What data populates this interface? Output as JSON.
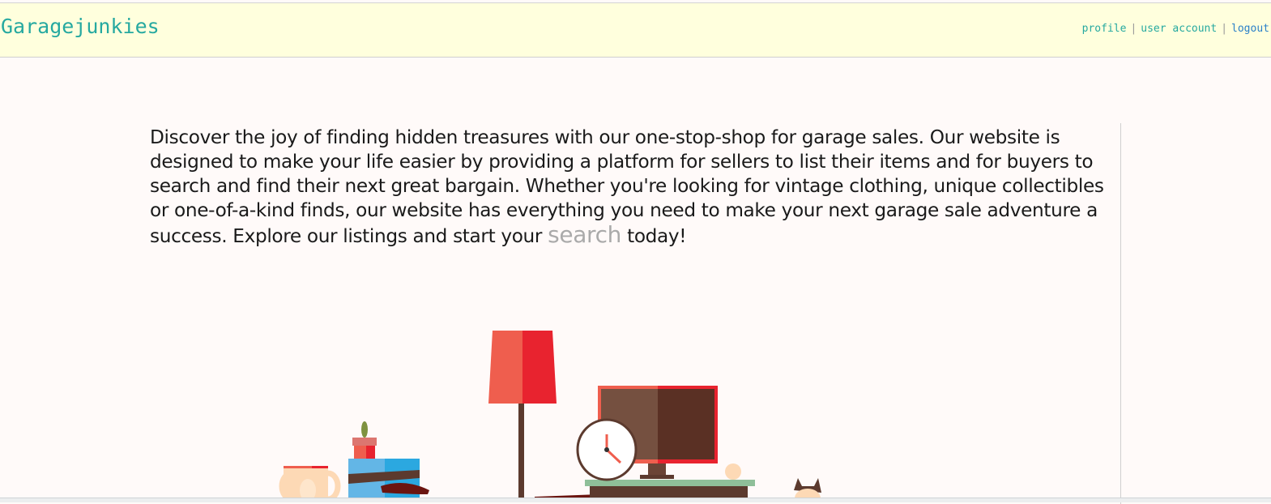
{
  "header": {
    "brand": "Garagejunkies",
    "nav": [
      {
        "label": "profile"
      },
      {
        "label": "user account"
      },
      {
        "label": "logout"
      }
    ],
    "separator": "|"
  },
  "main": {
    "intro_before": "Discover the joy of finding hidden treasures with our one-stop-shop for garage sales. Our website is designed to make your life easier by providing a platform for sellers to list their items and for buyers to search and find their next great bargain. Whether you're looking for vintage clothing, unique collectibles or one-of-a-kind finds, our website has everything you need to make your next garage sale adventure a success. Explore our listings and start your",
    "search_link": "search",
    "intro_after": "today!"
  },
  "colors": {
    "brand": "#26a9a0",
    "header_bg": "#ffffdd",
    "logout": "#2a80c8",
    "search_link": "#aaaaaa"
  }
}
